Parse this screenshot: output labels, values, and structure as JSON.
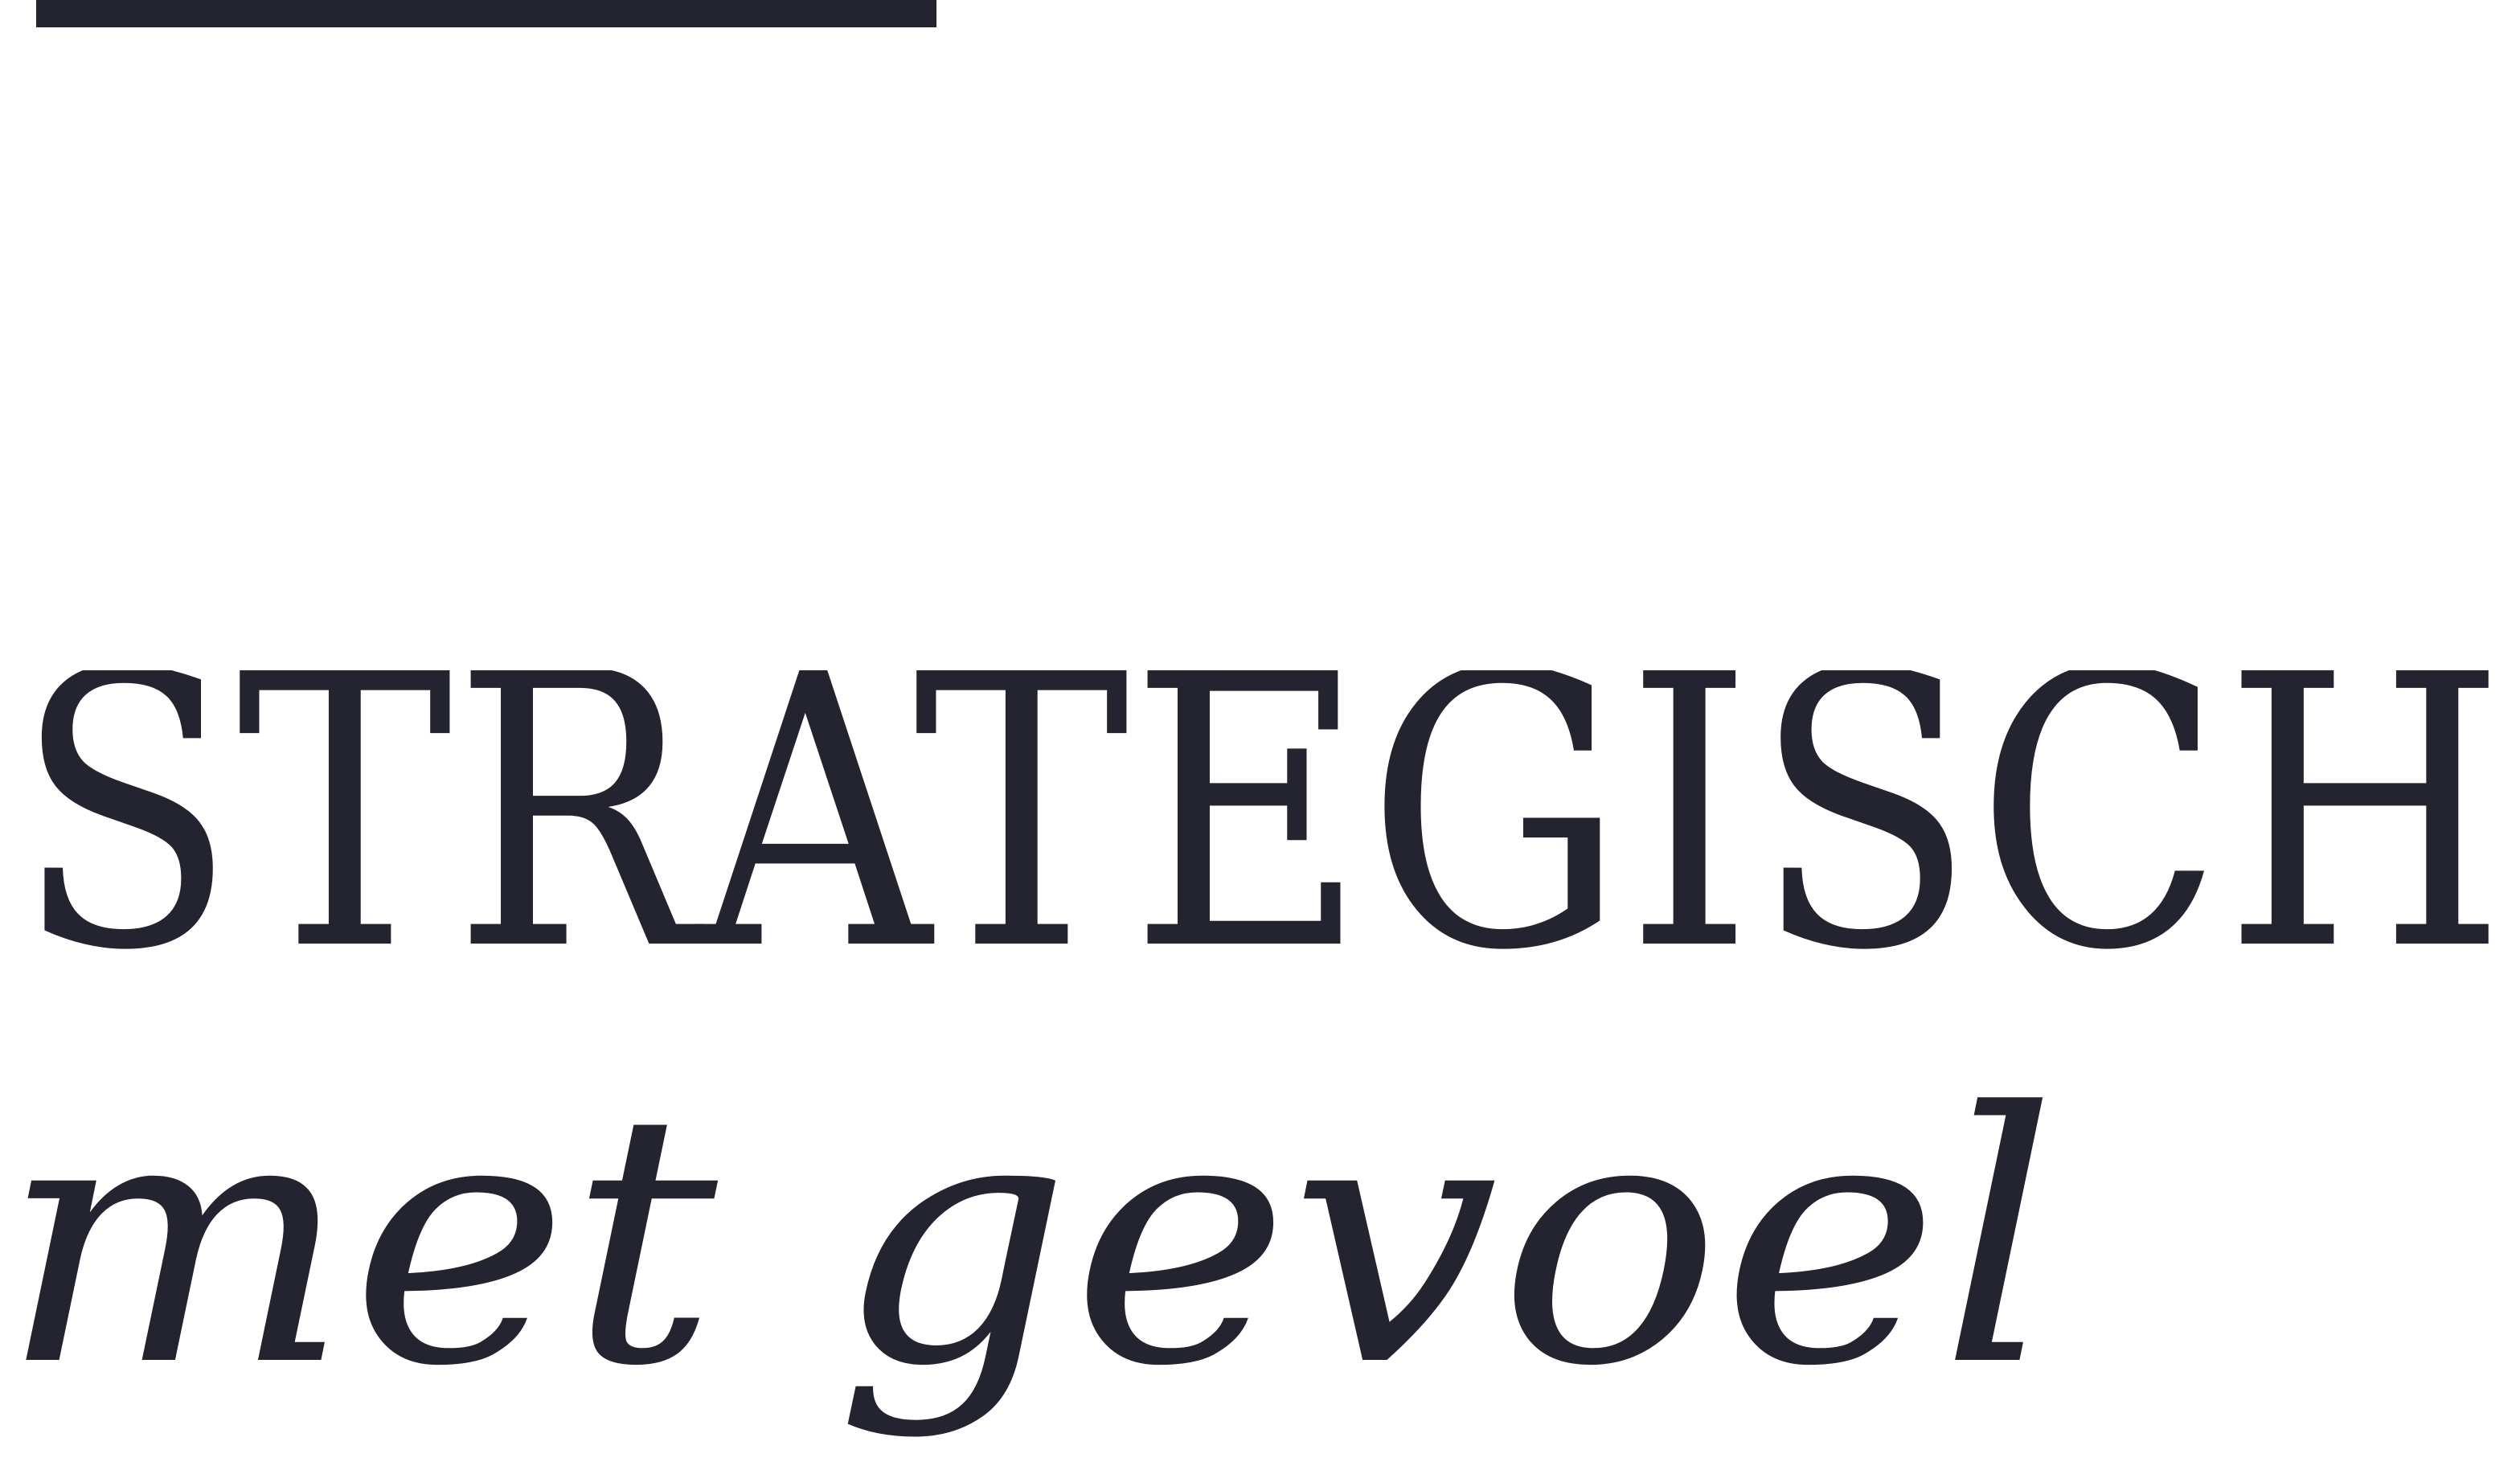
{
  "logo": {
    "headline": "STRATEGISCH",
    "tagline": "met gevoel"
  },
  "colors": {
    "ink": "#23242f",
    "background": "#ffffff"
  }
}
